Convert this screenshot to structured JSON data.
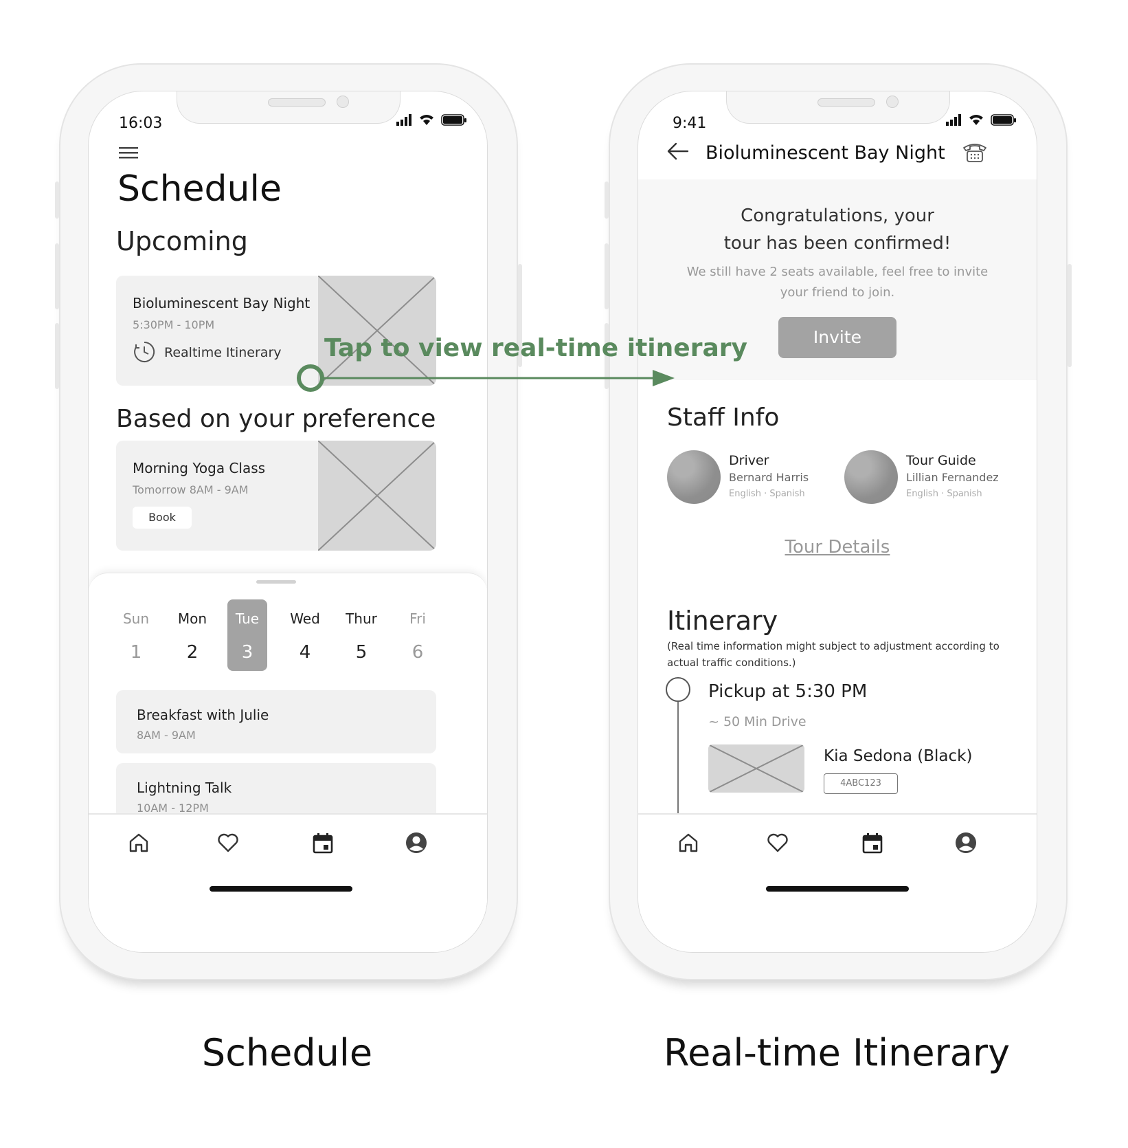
{
  "annotation": {
    "text": "Tap to view real-time itinerary",
    "color": "#5a8a5e"
  },
  "captions": {
    "left": "Schedule",
    "right": "Real-time Itinerary"
  },
  "schedule": {
    "status_time": "16:03",
    "title": "Schedule",
    "upcoming_heading": "Upcoming",
    "upcoming_card": {
      "title": "Bioluminescent Bay Night",
      "time": "5:30PM - 10PM",
      "link_label": "Realtime Itinerary"
    },
    "preference_heading": "Based on your preference",
    "preference_card": {
      "title": "Morning Yoga Class",
      "time": "Tomorrow 8AM - 9AM",
      "button_label": "Book"
    },
    "days": [
      {
        "name": "Sun",
        "num": "1"
      },
      {
        "name": "Mon",
        "num": "2"
      },
      {
        "name": "Tue",
        "num": "3"
      },
      {
        "name": "Wed",
        "num": "4"
      },
      {
        "name": "Thur",
        "num": "5"
      },
      {
        "name": "Fri",
        "num": "6"
      }
    ],
    "selected_day": "Tue",
    "events": [
      {
        "title": "Breakfast with Julie",
        "time": "8AM - 9AM"
      },
      {
        "title": "Lightning Talk",
        "time": "10AM - 12PM"
      }
    ]
  },
  "itinerary": {
    "status_time": "9:41",
    "header_title": "Bioluminescent Bay Night",
    "confirm_line1": "Congratulations, your",
    "confirm_line2": "tour has been confirmed!",
    "seats_line1": "We still have 2 seats available, feel free to invite",
    "seats_line2": "your friend to join.",
    "invite_label": "Invite",
    "staff_heading": "Staff Info",
    "staff": [
      {
        "role": "Driver",
        "name": "Bernard Harris",
        "languages": "English · Spanish"
      },
      {
        "role": "Tour Guide",
        "name": "Lillian Fernandez",
        "languages": "English · Spanish"
      }
    ],
    "tour_details_label": "Tour Details",
    "itinerary_heading": "Itinerary",
    "note_line1": "(Real time information might subject to adjustment according to",
    "note_line2": "actual traffic conditions.)",
    "pickup": "Pickup at 5:30 PM",
    "drive": "~ 50 Min Drive",
    "vehicle": "Kia Sedona (Black)",
    "plate": "4ABC123"
  },
  "icons": {
    "menu": "hamburger-menu-icon",
    "clock": "clock-icon",
    "back": "back-arrow-icon",
    "phone": "telephone-icon",
    "tabbar": [
      "home-icon",
      "heart-icon",
      "calendar-icon",
      "profile-icon"
    ]
  }
}
